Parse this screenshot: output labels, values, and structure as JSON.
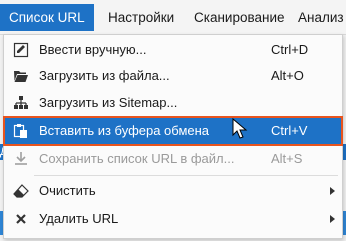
{
  "menubar": {
    "items": [
      {
        "label": "Список URL",
        "active": true
      },
      {
        "label": "Настройки"
      },
      {
        "label": "Сканирование"
      },
      {
        "label": "Анализ"
      }
    ]
  },
  "menu": {
    "items": [
      {
        "label": "Ввести вручную...",
        "shortcut": "Ctrl+D",
        "icon": "edit-icon"
      },
      {
        "label": "Загрузить из файла...",
        "shortcut": "Alt+O",
        "icon": "folder-open-icon"
      },
      {
        "label": "Загрузить из Sitemap...",
        "shortcut": "",
        "icon": "sitemap-icon"
      },
      {
        "label": "Вставить из буфера обмена",
        "shortcut": "Ctrl+V",
        "icon": "paste-icon",
        "highlighted": true
      },
      {
        "label": "Сохранить список URL в файл...",
        "shortcut": "Alt+S",
        "icon": "download-icon",
        "disabled": true
      },
      {
        "label": "Очистить",
        "shortcut": "",
        "icon": "eraser-icon",
        "submenu": true
      },
      {
        "label": "Удалить URL",
        "shortcut": "",
        "icon": "delete-icon",
        "submenu": true
      }
    ]
  },
  "background": {
    "left_fragment": "Да"
  },
  "colors": {
    "accent": "#1e72c6",
    "highlight_border": "#e8541e"
  }
}
